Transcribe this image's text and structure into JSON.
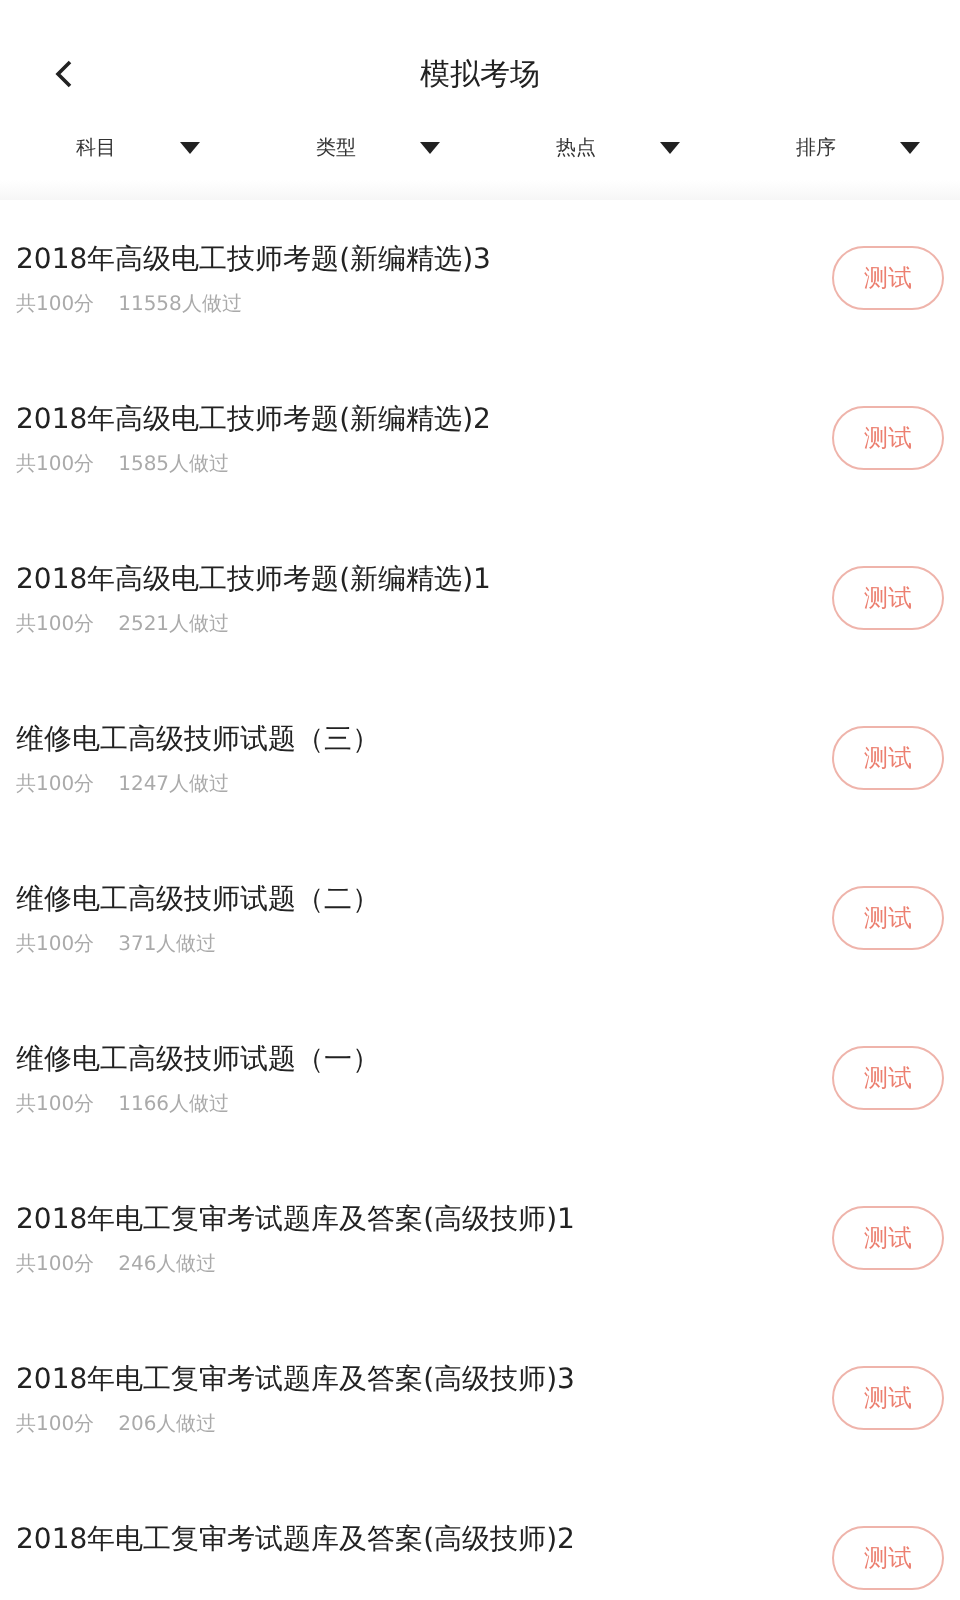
{
  "header": {
    "title": "模拟考场"
  },
  "filters": [
    {
      "label": "科目"
    },
    {
      "label": "类型"
    },
    {
      "label": "热点"
    },
    {
      "label": "排序"
    }
  ],
  "exams": [
    {
      "title": "2018年高级电工技师考题(新编精选)3",
      "score": "共100分",
      "count": "11558人做过",
      "action": "测试"
    },
    {
      "title": "2018年高级电工技师考题(新编精选)2",
      "score": "共100分",
      "count": "1585人做过",
      "action": "测试"
    },
    {
      "title": "2018年高级电工技师考题(新编精选)1",
      "score": "共100分",
      "count": "2521人做过",
      "action": "测试"
    },
    {
      "title": "维修电工高级技师试题（三）",
      "score": "共100分",
      "count": "1247人做过",
      "action": "测试"
    },
    {
      "title": "维修电工高级技师试题（二）",
      "score": "共100分",
      "count": "371人做过",
      "action": "测试"
    },
    {
      "title": "维修电工高级技师试题（一）",
      "score": "共100分",
      "count": "1166人做过",
      "action": "测试"
    },
    {
      "title": "2018年电工复审考试题库及答案(高级技师)1",
      "score": "共100分",
      "count": "246人做过",
      "action": "测试"
    },
    {
      "title": "2018年电工复审考试题库及答案(高级技师)3",
      "score": "共100分",
      "count": "206人做过",
      "action": "测试"
    },
    {
      "title": "2018年电工复审考试题库及答案(高级技师)2",
      "action": "测试"
    }
  ]
}
